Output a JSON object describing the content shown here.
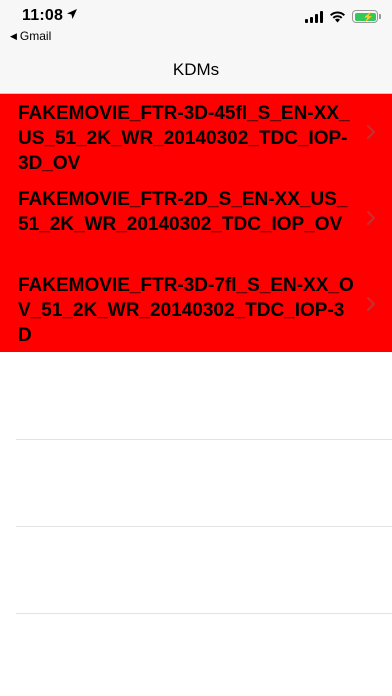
{
  "status_bar": {
    "time": "11:08",
    "back_app_label": "Gmail",
    "battery_color": "#34c759"
  },
  "nav": {
    "title": "KDMs"
  },
  "list": {
    "background": "#ff0000",
    "items": [
      {
        "label": "FAKEMOVIE_FTR-3D-45fl_S_EN-XX_US_51_2K_WR_20140302_TDC_IOP-3D_OV"
      },
      {
        "label": "FAKEMOVIE_FTR-2D_S_EN-XX_US_51_2K_WR_20140302_TDC_IOP_OV"
      },
      {
        "label": "FAKEMOVIE_FTR-3D-7fl_S_EN-XX_OV_51_2K_WR_20140302_TDC_IOP-3D"
      }
    ]
  }
}
